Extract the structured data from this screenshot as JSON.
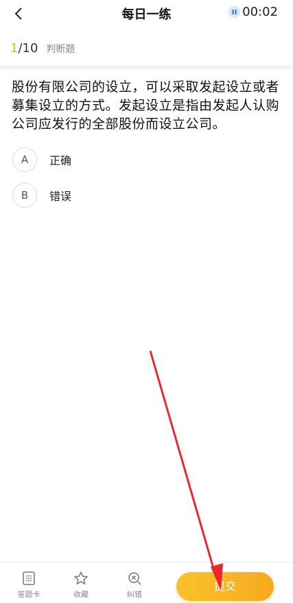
{
  "header": {
    "title": "每日一练",
    "timer": "00:02"
  },
  "progress": {
    "current": "1",
    "separator": "/",
    "total": "10",
    "question_type": "判断题"
  },
  "question": {
    "text": "股份有限公司的设立，可以采取发起设立或者募集设立的方式。发起设立是指由发起人认购公司应发行的全部股份而设立公司。"
  },
  "options": [
    {
      "letter": "A",
      "label": "正确"
    },
    {
      "letter": "B",
      "label": "错误"
    }
  ],
  "toolbar": {
    "answer_card": "答题卡",
    "favorite": "收藏",
    "report_error": "纠错",
    "submit": "提交"
  },
  "colors": {
    "accent": "#f6b400",
    "submit_start": "#f9c22a",
    "submit_end": "#f7a91e",
    "annotation_arrow": "#e8282e"
  }
}
